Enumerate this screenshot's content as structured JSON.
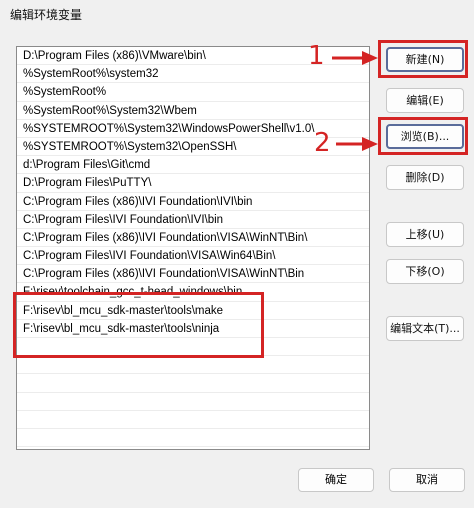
{
  "window": {
    "title": "编辑环境变量"
  },
  "paths": [
    "D:\\Program Files (x86)\\VMware\\bin\\",
    "%SystemRoot%\\system32",
    "%SystemRoot%",
    "%SystemRoot%\\System32\\Wbem",
    "%SYSTEMROOT%\\System32\\WindowsPowerShell\\v1.0\\",
    "%SYSTEMROOT%\\System32\\OpenSSH\\",
    "d:\\Program Files\\Git\\cmd",
    "D:\\Program Files\\PuTTY\\",
    "C:\\Program Files (x86)\\IVI Foundation\\IVI\\bin",
    "C:\\Program Files\\IVI Foundation\\IVI\\bin",
    "C:\\Program Files (x86)\\IVI Foundation\\VISA\\WinNT\\Bin\\",
    "C:\\Program Files\\IVI Foundation\\VISA\\Win64\\Bin\\",
    "C:\\Program Files (x86)\\IVI Foundation\\VISA\\WinNT\\Bin",
    "F:\\risev\\toolchain_gcc_t-head_windows\\bin",
    "F:\\risev\\bl_mcu_sdk-master\\tools\\make",
    "F:\\risev\\bl_mcu_sdk-master\\tools\\ninja",
    "",
    "",
    "",
    "",
    "",
    ""
  ],
  "buttons": {
    "new": "新建(N)",
    "edit": "编辑(E)",
    "browse": "浏览(B)...",
    "delete": "删除(D)",
    "move_up": "上移(U)",
    "move_down": "下移(O)",
    "edit_text": "编辑文本(T)...",
    "ok": "确定",
    "cancel": "取消"
  },
  "annotations": {
    "marker_1": "1",
    "marker_2": "2",
    "color": "#d42424"
  }
}
